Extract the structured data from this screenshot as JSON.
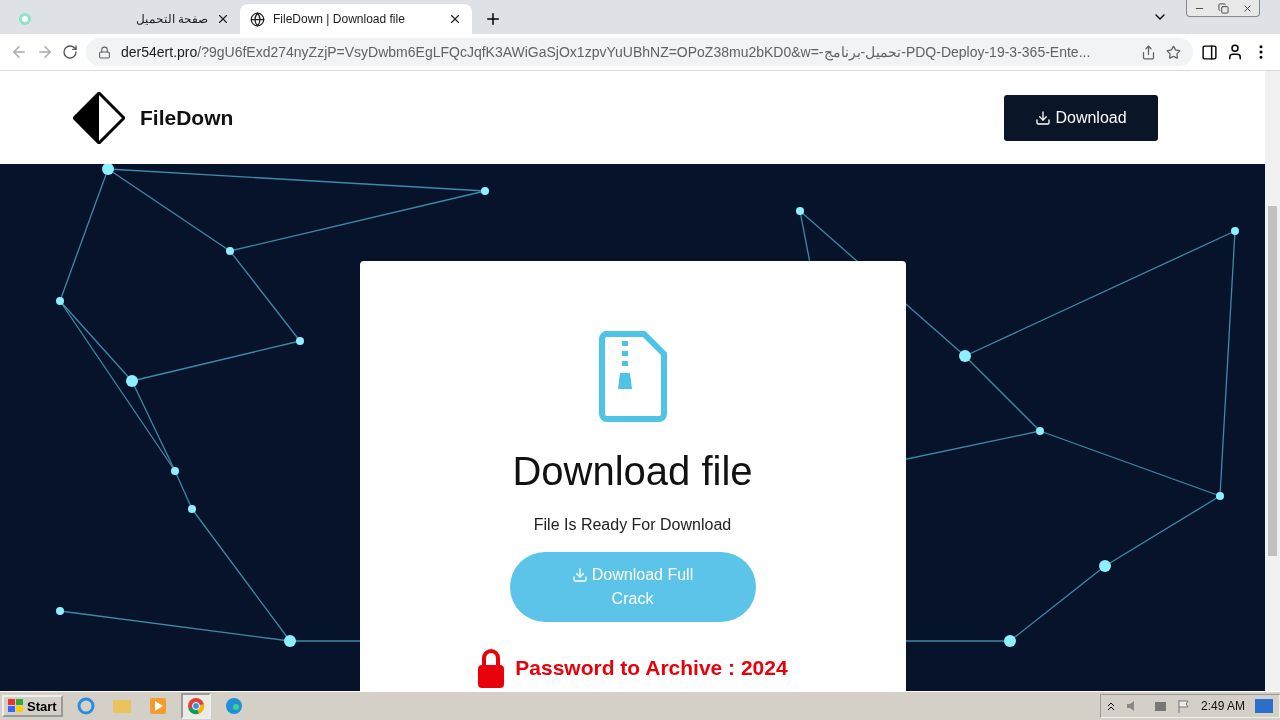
{
  "browser": {
    "tabs": [
      {
        "title": "صفحة التحميل",
        "selected": false
      },
      {
        "title": "FileDown | Download file",
        "selected": true
      }
    ],
    "url_domain": "der54ert.pro",
    "url_rest": "/?9gU6fExd274nyZzjP=VsyDwbm6EgLFQcJqfK3AWiGaSjOx1zpvYuUBhNZ=OPoZ38mu2bKD0&w=-تحميل-برنامج-PDQ-Deploy-19-3-365-Ente..."
  },
  "header": {
    "logo": "FileDown",
    "button": "Download"
  },
  "card": {
    "title": "Download file",
    "subtitle": "File Is Ready For Download",
    "button_lines": [
      "Download Full",
      "Crack"
    ],
    "password": "Password to Archive : 2024"
  },
  "taskbar": {
    "start": "Start",
    "clock": "2:49 AM"
  }
}
